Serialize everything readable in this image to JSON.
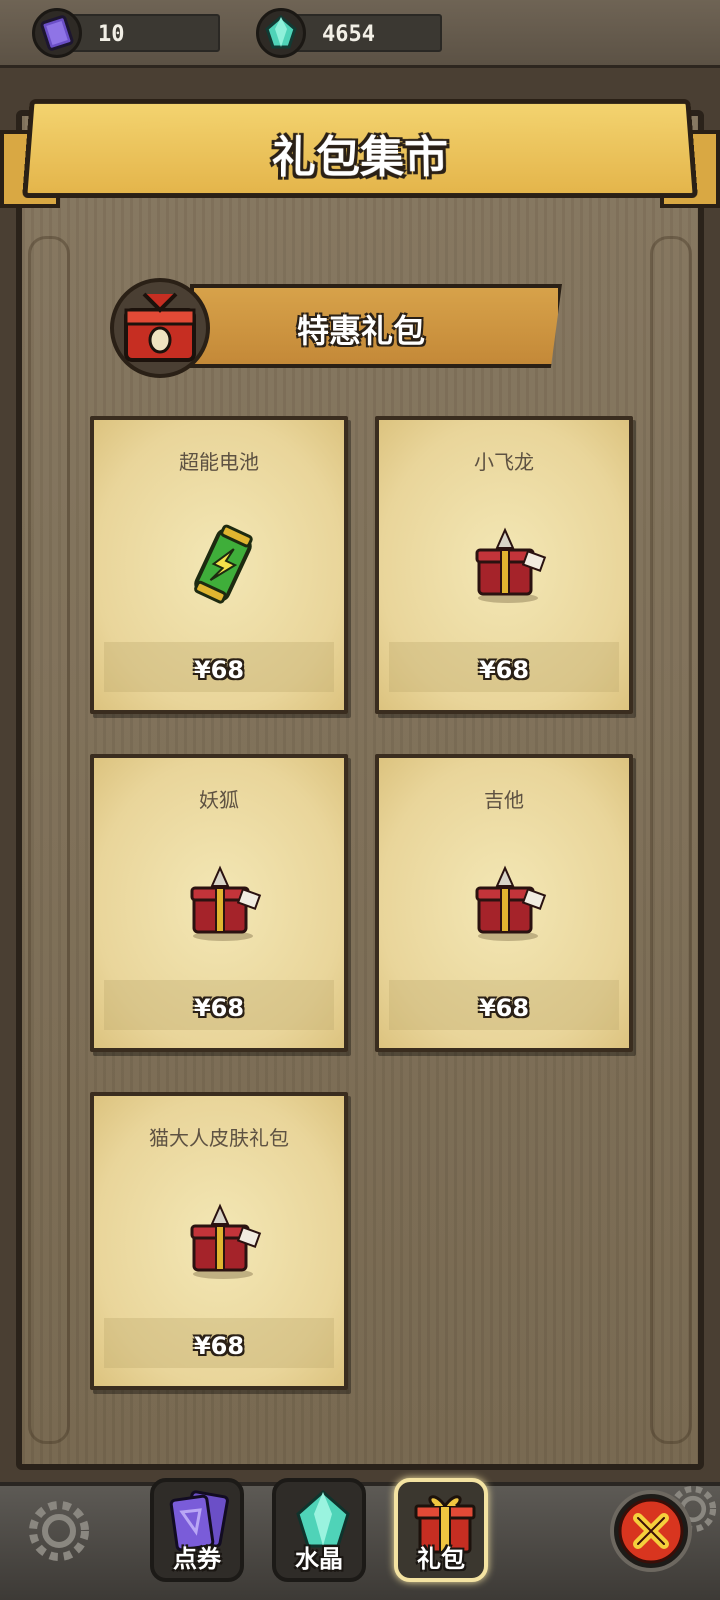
{
  "currency": {
    "tickets": "10",
    "crystals": "4654"
  },
  "header": {
    "title": "礼包集市"
  },
  "section": {
    "title": "特惠礼包"
  },
  "packs": [
    {
      "name": "超能电池",
      "price": "¥68",
      "icon": "battery-icon"
    },
    {
      "name": "小飞龙",
      "price": "¥68",
      "icon": "gift-chest-icon"
    },
    {
      "name": "妖狐",
      "price": "¥68",
      "icon": "gift-chest-icon"
    },
    {
      "name": "吉他",
      "price": "¥68",
      "icon": "gift-chest-icon"
    },
    {
      "name": "猫大人皮肤礼包",
      "price": "¥68",
      "icon": "gift-chest-icon"
    }
  ],
  "tabs": [
    {
      "label": "点券",
      "icon": "ticket-cards-icon",
      "active": false
    },
    {
      "label": "水晶",
      "icon": "crystal-icon",
      "active": false
    },
    {
      "label": "礼包",
      "icon": "gift-box-icon",
      "active": true
    }
  ],
  "colors": {
    "ribbon": "#e4b54b",
    "card": "#f3e7b5",
    "accent_red": "#c62e22"
  }
}
